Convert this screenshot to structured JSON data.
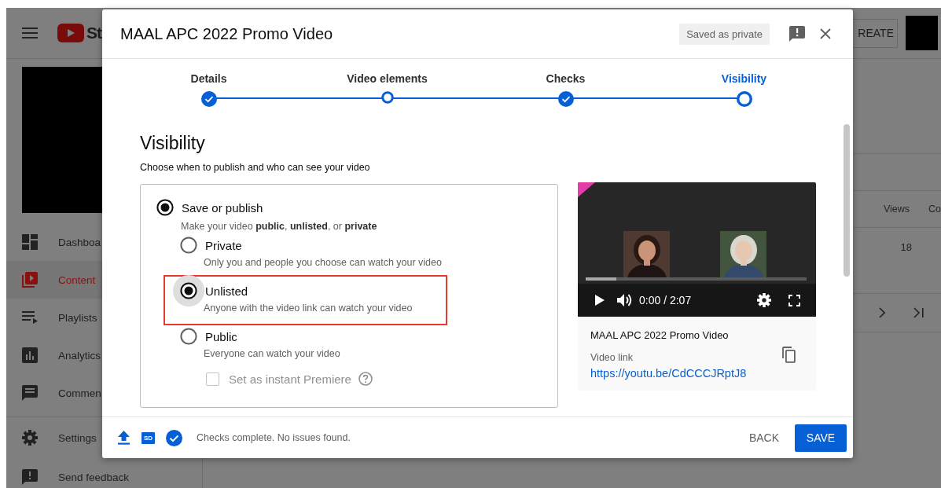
{
  "background": {
    "logo_text": "St",
    "create_button": "REATE",
    "sidebar": {
      "items": [
        {
          "label": "Dashboa",
          "selected": false
        },
        {
          "label": "Content",
          "selected": true
        },
        {
          "label": "Playlists",
          "selected": false
        },
        {
          "label": "Analytics",
          "selected": false
        },
        {
          "label": "Commen",
          "selected": false
        },
        {
          "label": "Settings",
          "selected": false
        },
        {
          "label": "Send feedback",
          "selected": false
        }
      ]
    },
    "table": {
      "columns": [
        "Views",
        "Co"
      ],
      "rows": [
        [
          "18"
        ]
      ]
    }
  },
  "dialog": {
    "title": "MAAL APC 2022 Promo Video",
    "save_status": "Saved as private",
    "steps": [
      {
        "label": "Details",
        "kind": "done",
        "selected": false
      },
      {
        "label": "Video elements",
        "kind": "open",
        "selected": false
      },
      {
        "label": "Checks",
        "kind": "done",
        "selected": false
      },
      {
        "label": "Visibility",
        "kind": "open",
        "selected": true
      }
    ],
    "heading": "Visibility",
    "subheading": "Choose when to publish and who can see your video",
    "save_or_publish": {
      "label": "Save or publish",
      "selected": true,
      "description": "Make your video **public**, **unlisted**, or **private**",
      "options": [
        {
          "label": "Private",
          "description": "Only you and people you choose can watch your video",
          "selected": false,
          "highlighted": false
        },
        {
          "label": "Unlisted",
          "description": "Anyone with the video link can watch your video",
          "selected": true,
          "highlighted": true
        },
        {
          "label": "Public",
          "description": "Everyone can watch your video",
          "selected": false,
          "highlighted": false
        }
      ],
      "premiere": {
        "label": "Set as instant Premiere",
        "checked": false,
        "disabled": true
      }
    },
    "preview": {
      "time": "0:00 / 2:07",
      "level": 0.14,
      "title": "MAAL APC 2022 Promo Video",
      "link_label": "Video link",
      "link": "https://youtu.be/CdCCCJRptJ8"
    },
    "footer": {
      "sd_badge": "SD",
      "status": "Checks complete. No issues found.",
      "buttons": [
        {
          "label": "BACK",
          "kind": "text"
        },
        {
          "label": "SAVE",
          "kind": "primary"
        }
      ]
    }
  }
}
